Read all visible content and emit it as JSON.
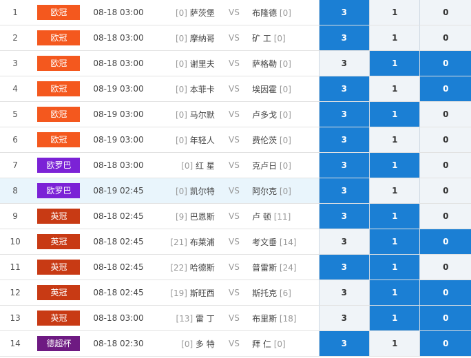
{
  "rows": [
    {
      "no": "1",
      "league": "欧冠",
      "league_color": "#f4581e",
      "time": "08-18 03:00",
      "home_rank": "[0]",
      "home": "萨茨堡",
      "vs": "VS",
      "away": "布隆德",
      "away_rank": "[0]",
      "b": [
        "3",
        "1",
        "0"
      ],
      "sel": [
        1,
        0,
        0
      ]
    },
    {
      "no": "2",
      "league": "欧冠",
      "league_color": "#f4581e",
      "time": "08-18 03:00",
      "home_rank": "[0]",
      "home": "摩纳哥",
      "vs": "VS",
      "away": "矿 工",
      "away_rank": "[0]",
      "b": [
        "3",
        "1",
        "0"
      ],
      "sel": [
        1,
        0,
        0
      ]
    },
    {
      "no": "3",
      "league": "欧冠",
      "league_color": "#f4581e",
      "time": "08-18 03:00",
      "home_rank": "[0]",
      "home": "谢里夫",
      "vs": "VS",
      "away": "萨格勒",
      "away_rank": "[0]",
      "b": [
        "3",
        "1",
        "0"
      ],
      "sel": [
        0,
        1,
        1
      ]
    },
    {
      "no": "4",
      "league": "欧冠",
      "league_color": "#f4581e",
      "time": "08-19 03:00",
      "home_rank": "[0]",
      "home": "本菲卡",
      "vs": "VS",
      "away": "埃因霍",
      "away_rank": "[0]",
      "b": [
        "3",
        "1",
        "0"
      ],
      "sel": [
        1,
        0,
        1
      ]
    },
    {
      "no": "5",
      "league": "欧冠",
      "league_color": "#f4581e",
      "time": "08-19 03:00",
      "home_rank": "[0]",
      "home": "马尔默",
      "vs": "VS",
      "away": "卢多戈",
      "away_rank": "[0]",
      "b": [
        "3",
        "1",
        "0"
      ],
      "sel": [
        1,
        1,
        0
      ]
    },
    {
      "no": "6",
      "league": "欧冠",
      "league_color": "#f4581e",
      "time": "08-19 03:00",
      "home_rank": "[0]",
      "home": "年轻人",
      "vs": "VS",
      "away": "费伦茨",
      "away_rank": "[0]",
      "b": [
        "3",
        "1",
        "0"
      ],
      "sel": [
        1,
        0,
        0
      ]
    },
    {
      "no": "7",
      "league": "欧罗巴",
      "league_color": "#7b22d6",
      "time": "08-18 03:00",
      "home_rank": "[0]",
      "home": "红 星",
      "vs": "VS",
      "away": "克卢日",
      "away_rank": "[0]",
      "b": [
        "3",
        "1",
        "0"
      ],
      "sel": [
        1,
        1,
        0
      ]
    },
    {
      "no": "8",
      "league": "欧罗巴",
      "league_color": "#7b22d6",
      "time": "08-19 02:45",
      "home_rank": "[0]",
      "home": "凯尔特",
      "vs": "VS",
      "away": "阿尔克",
      "away_rank": "[0]",
      "b": [
        "3",
        "1",
        "0"
      ],
      "sel": [
        1,
        0,
        0
      ],
      "highlight": true
    },
    {
      "no": "9",
      "league": "英冠",
      "league_color": "#c83a14",
      "time": "08-18 02:45",
      "home_rank": "[9]",
      "home": "巴恩斯",
      "vs": "VS",
      "away": "卢 顿",
      "away_rank": "[11]",
      "b": [
        "3",
        "1",
        "0"
      ],
      "sel": [
        1,
        1,
        0
      ]
    },
    {
      "no": "10",
      "league": "英冠",
      "league_color": "#c83a14",
      "time": "08-18 02:45",
      "home_rank": "[21]",
      "home": "布莱浦",
      "vs": "VS",
      "away": "考文垂",
      "away_rank": "[14]",
      "b": [
        "3",
        "1",
        "0"
      ],
      "sel": [
        0,
        1,
        1
      ]
    },
    {
      "no": "11",
      "league": "英冠",
      "league_color": "#c83a14",
      "time": "08-18 02:45",
      "home_rank": "[22]",
      "home": "哈德斯",
      "vs": "VS",
      "away": "普雷斯",
      "away_rank": "[24]",
      "b": [
        "3",
        "1",
        "0"
      ],
      "sel": [
        1,
        1,
        0
      ]
    },
    {
      "no": "12",
      "league": "英冠",
      "league_color": "#c83a14",
      "time": "08-18 02:45",
      "home_rank": "[19]",
      "home": "斯旺西",
      "vs": "VS",
      "away": "斯托克",
      "away_rank": "[6]",
      "b": [
        "3",
        "1",
        "0"
      ],
      "sel": [
        0,
        1,
        1
      ]
    },
    {
      "no": "13",
      "league": "英冠",
      "league_color": "#c83a14",
      "time": "08-18 03:00",
      "home_rank": "[13]",
      "home": "雷 丁",
      "vs": "VS",
      "away": "布里斯",
      "away_rank": "[18]",
      "b": [
        "3",
        "1",
        "0"
      ],
      "sel": [
        0,
        1,
        1
      ]
    },
    {
      "no": "14",
      "league": "德超杯",
      "league_color": "#6e1a82",
      "time": "08-18 02:30",
      "home_rank": "[0]",
      "home": "多 特",
      "vs": "VS",
      "away": "拜 仁",
      "away_rank": "[0]",
      "b": [
        "3",
        "1",
        "0"
      ],
      "sel": [
        1,
        0,
        1
      ]
    }
  ]
}
